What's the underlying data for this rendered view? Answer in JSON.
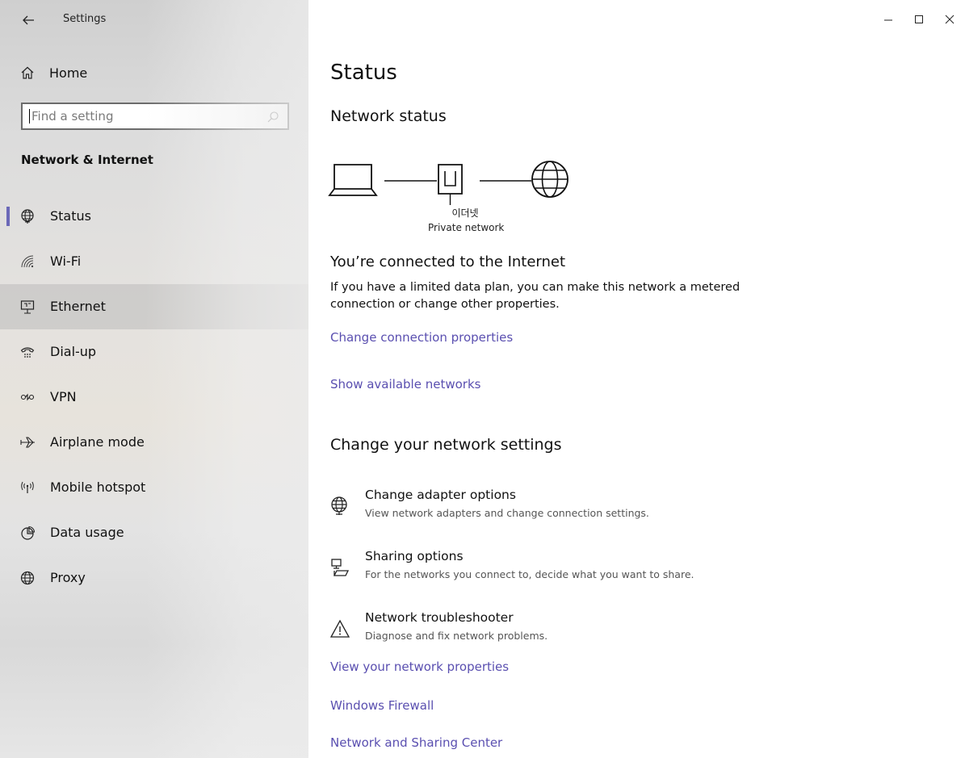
{
  "window": {
    "title": "Settings",
    "controls": [
      "minimize-icon",
      "maximize-icon",
      "close-icon"
    ]
  },
  "sidebar": {
    "home_label": "Home",
    "search": {
      "placeholder": "Find a setting"
    },
    "section_title": "Network & Internet",
    "items": [
      {
        "label": "Status",
        "icon": "globe-network-icon",
        "selected": true
      },
      {
        "label": "Wi-Fi",
        "icon": "wifi-icon"
      },
      {
        "label": "Ethernet",
        "icon": "ethernet-icon",
        "hovered": true
      },
      {
        "label": "Dial-up",
        "icon": "dialup-icon"
      },
      {
        "label": "VPN",
        "icon": "vpn-icon"
      },
      {
        "label": "Airplane mode",
        "icon": "airplane-icon"
      },
      {
        "label": "Mobile hotspot",
        "icon": "hotspot-icon"
      },
      {
        "label": "Data usage",
        "icon": "data-usage-icon"
      },
      {
        "label": "Proxy",
        "icon": "globe-icon"
      }
    ]
  },
  "main": {
    "title": "Status",
    "network_status_heading": "Network status",
    "network": {
      "name": "이더넷",
      "type": "Private network"
    },
    "connected_title": "You’re connected to the Internet",
    "connected_desc": "If you have a limited data plan, you can make this network a metered connection or change other properties.",
    "link_change_connection": "Change connection properties",
    "link_show_networks": "Show available networks",
    "change_settings_heading": "Change your network settings",
    "options": [
      {
        "title": "Change adapter options",
        "desc": "View network adapters and change connection settings.",
        "icon": "adapter-icon"
      },
      {
        "title": "Sharing options",
        "desc": "For the networks you connect to, decide what you want to share.",
        "icon": "sharing-icon"
      },
      {
        "title": "Network troubleshooter",
        "desc": "Diagnose and fix network problems.",
        "icon": "warning-icon"
      }
    ],
    "link_view_properties": "View your network properties",
    "link_firewall": "Windows Firewall",
    "link_sharing_center": "Network and Sharing Center"
  },
  "colors": {
    "accent": "#6b68b8",
    "link": "#5a4fb0"
  }
}
